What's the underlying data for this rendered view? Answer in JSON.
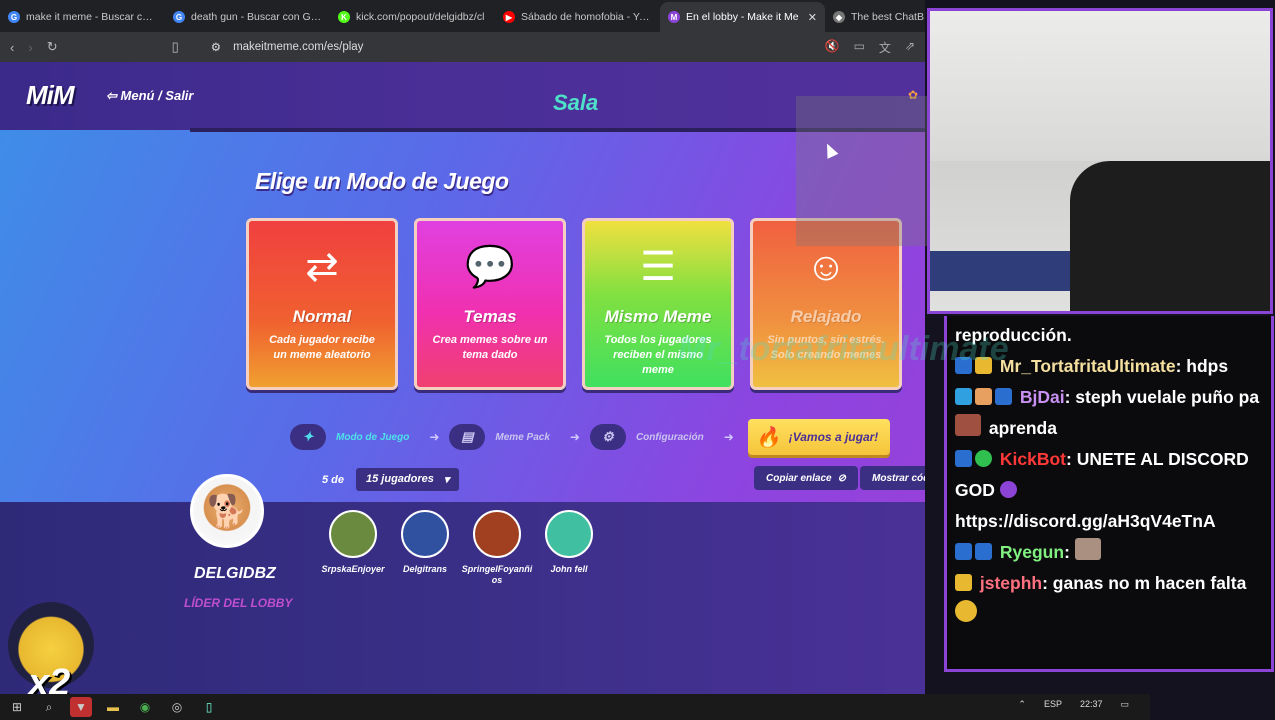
{
  "browser": {
    "tabs": [
      {
        "label": "make it meme - Buscar con G",
        "fav": "G",
        "color": "#4285f4"
      },
      {
        "label": "death gun - Buscar con Goog",
        "fav": "G",
        "color": "#4285f4"
      },
      {
        "label": "kick.com/popout/delgidbz/cl",
        "fav": "K",
        "color": "#53fc18"
      },
      {
        "label": "Sábado de homofobia - YouT",
        "fav": "▶",
        "color": "#ff0000"
      },
      {
        "label": "En el lobby - Make it Me",
        "fav": "M",
        "color": "#8b44d6"
      },
      {
        "label": "The best ChatB",
        "fav": "◆",
        "color": "#777"
      }
    ],
    "active_tab_index": 4,
    "url": "makeitmeme.com/es/play"
  },
  "app": {
    "logo": "MiM",
    "menu_exit": "Menú / Salir",
    "page_title": "Sala",
    "choose_mode": "Elige un Modo de Juego",
    "modes": [
      {
        "name": "Normal",
        "desc": "Cada jugador recibe un meme aleatorio",
        "icon": "⇄"
      },
      {
        "name": "Temas",
        "desc": "Crea memes sobre un tema dado",
        "icon": "💬"
      },
      {
        "name": "Mismo Meme",
        "desc": "Todos los jugadores reciben el mismo meme",
        "icon": "☰"
      },
      {
        "name": "Relajado",
        "desc": "Sin puntos, sin estrés. Solo creando memes",
        "icon": "☺"
      }
    ],
    "steps": [
      {
        "label": "Modo de Juego",
        "icon": "✦"
      },
      {
        "label": "Meme Pack",
        "icon": "▤"
      },
      {
        "label": "Configuración",
        "icon": "⚙"
      }
    ],
    "play_label": "¡Vamos a jugar!",
    "lobby": {
      "leader_name": "DELGIDBZ",
      "leader_role": "LÍDER DEL LOBBY",
      "count_prefix": "5 de",
      "max_players": "15 jugadores",
      "copy_link": "Copiar enlace",
      "show_code": "Mostrar código",
      "players": [
        {
          "name": "SrpskaEnjoyer",
          "color": "#6a8a40"
        },
        {
          "name": "Delgitrans",
          "color": "#3050a0"
        },
        {
          "name": "SpringelFoyanñi os",
          "color": "#a04020"
        },
        {
          "name": "John fell",
          "color": "#40c0a0"
        }
      ]
    }
  },
  "overlay": {
    "watermark": "Mr_tortafritaultimate",
    "emote_multiplier": "x2",
    "chat": [
      {
        "text": "reproducción."
      },
      {
        "user": "Mr_TortafritaUltimate",
        "msg": ": hdps",
        "color": "#f5e0a0"
      },
      {
        "user": "BjDai",
        "msg": ": steph vuelale puño pa",
        "tail": "aprenda",
        "color": "#c890f0"
      },
      {
        "user": "KickBot",
        "msg": ": UNETE AL DISCORD GOD",
        "color": "#ff3838"
      },
      {
        "text": "https://discord.gg/aH3qV4eTnA"
      },
      {
        "user": "Ryegun",
        "msg": ":",
        "color": "#80f080"
      },
      {
        "user": "jstephh",
        "msg": ": ganas no m hacen falta",
        "color": "#ff7080"
      }
    ]
  },
  "taskbar": {
    "lang": "ESP",
    "time": "22:37"
  }
}
